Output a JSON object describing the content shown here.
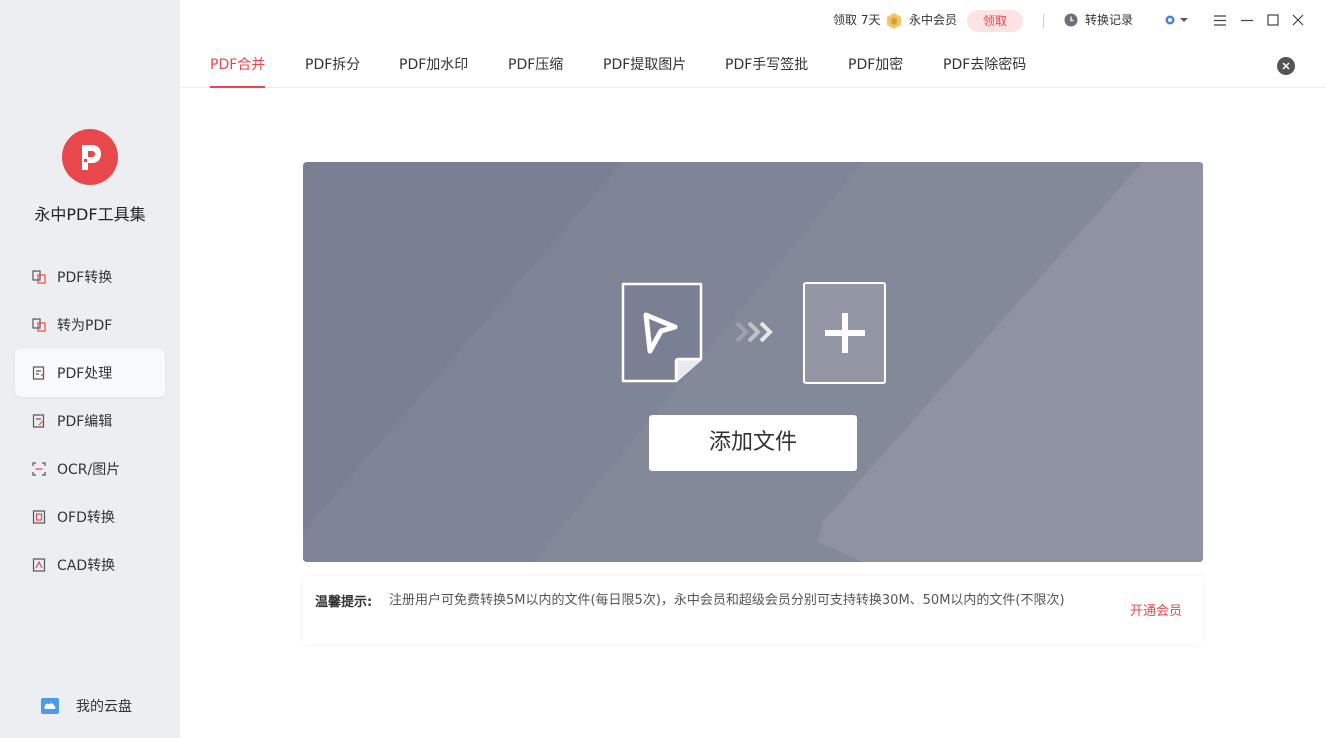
{
  "app": {
    "name": "永中PDF工具集"
  },
  "sidebar": {
    "items": [
      {
        "label": "PDF转换",
        "icon": "convert-icon",
        "active": false
      },
      {
        "label": "转为PDF",
        "icon": "to-pdf-icon",
        "active": false
      },
      {
        "label": "PDF处理",
        "icon": "process-icon",
        "active": true
      },
      {
        "label": "PDF编辑",
        "icon": "edit-icon",
        "active": false
      },
      {
        "label": "OCR/图片",
        "icon": "ocr-icon",
        "active": false
      },
      {
        "label": "OFD转换",
        "icon": "ofd-icon",
        "active": false
      },
      {
        "label": "CAD转换",
        "icon": "cad-icon",
        "active": false
      }
    ],
    "cloud_label": "我的云盘"
  },
  "topbar": {
    "claim_days": "领取 7天",
    "member_label": "永中会员",
    "claim_button": "领取",
    "history_label": "转换记录"
  },
  "tabs": [
    {
      "label": "PDF合并",
      "active": true
    },
    {
      "label": "PDF拆分",
      "active": false
    },
    {
      "label": "PDF加水印",
      "active": false
    },
    {
      "label": "PDF压缩",
      "active": false
    },
    {
      "label": "PDF提取图片",
      "active": false
    },
    {
      "label": "PDF手写签批",
      "active": false
    },
    {
      "label": "PDF加密",
      "active": false
    },
    {
      "label": "PDF去除密码",
      "active": false
    }
  ],
  "dropzone": {
    "add_button": "添加文件"
  },
  "tips": {
    "label": "温馨提示:",
    "text": "注册用户可免费转换5M以内的文件(每日限5次)，永中会员和超级会员分别可支持转换30M、50M以内的文件(不限次)",
    "link": "开通会员"
  },
  "colors": {
    "accent": "#e8484b",
    "sidebar_bg": "#eceef2",
    "dropzone_bg": "#7a7f93"
  }
}
